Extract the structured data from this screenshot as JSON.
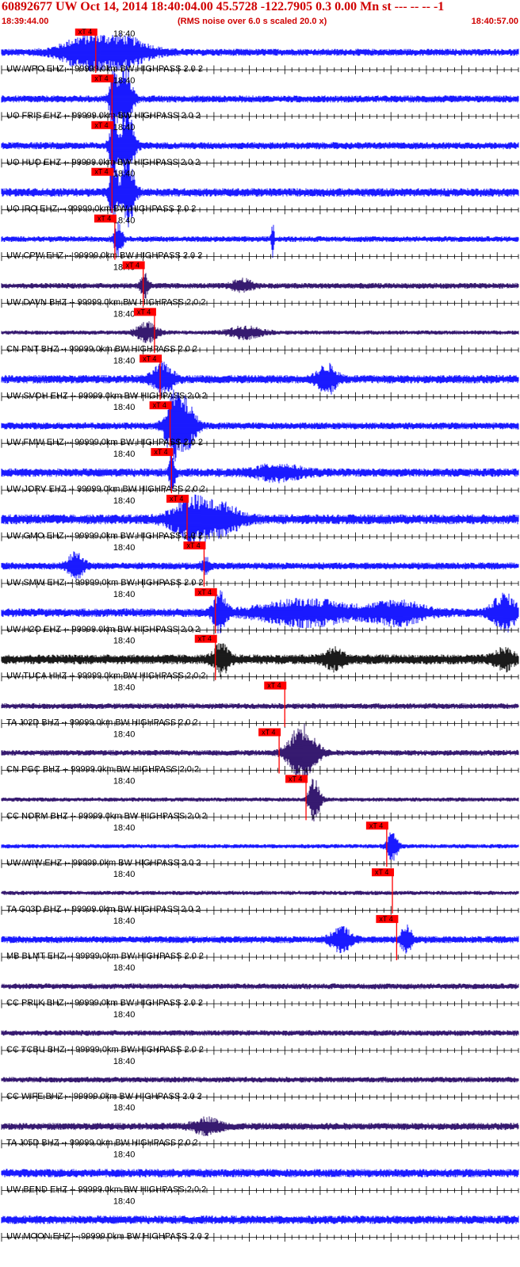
{
  "header": {
    "title": "60892677 UW Oct 14, 2014 18:40:04.00   45.5728 -122.7905  0.3 0.00 Mn st --- -- --  -1",
    "start_time": "18:39:44.00",
    "rms_note": "(RMS noise over 6.0 s scaled 20.0 x)",
    "end_time": "18:40:57.00"
  },
  "chart_data": {
    "type": "line",
    "title": "60892677 UW Oct 14, 2014 18:40:04.00   45.5728 -122.7905  0.3 0.00 Mn st --- -- --  -1",
    "x_range_seconds": [
      0,
      73
    ],
    "time_label": "18:40",
    "time_label_seconds": 16,
    "pick_label": "xT 4",
    "colors": {
      "blue": "#0000ff",
      "purple": "#200060",
      "black": "#000000",
      "pick": "#ff0000",
      "text_red": "#d00000"
    },
    "traces": [
      {
        "label": "UW WPO EHZ -- 99999.0km BW  HIGHPASS  2.0  2",
        "color": "blue",
        "noise": 0.25,
        "pick": 13.3,
        "events": [
          [
            11.5,
            3.5,
            0.9
          ],
          [
            17,
            4,
            1.0
          ]
        ]
      },
      {
        "label": "UO FRIS EHZ -- 99999.0km BW  HIGHPASS  2.0  2",
        "color": "blue",
        "noise": 0.25,
        "pick": 15.6,
        "events": [
          [
            15.8,
            0.6,
            2.0
          ],
          [
            17.5,
            1.0,
            2.2
          ]
        ]
      },
      {
        "label": "UO HUO EHZ -- 99999.0km BW  HIGHPASS  2.0  2",
        "color": "blue",
        "noise": 0.25,
        "pick": 15.6,
        "events": [
          [
            15.8,
            0.6,
            2.0
          ],
          [
            17.8,
            1.0,
            2.2
          ]
        ]
      },
      {
        "label": "UO IRO EHZ -- 99999.0km BW  HIGHPASS  2.0  2",
        "color": "blue",
        "noise": 0.3,
        "pick": 15.6,
        "events": [
          [
            15.8,
            0.6,
            2.0
          ],
          [
            17.8,
            1.0,
            2.2
          ]
        ]
      },
      {
        "label": "UW CPW EHZ -- 99999.0km BW  HIGHPASS  2.0  2",
        "color": "blue",
        "noise": 0.2,
        "pick": 16.0,
        "events": [
          [
            16.5,
            0.6,
            1.2
          ],
          [
            38.3,
            0.2,
            1.2
          ]
        ]
      },
      {
        "label": "UW DAVN BHZ -- 99999.0km BW  HIGHPASS  2.0  2",
        "color": "purple",
        "noise": 0.2,
        "pick": 20.0,
        "events": [
          [
            20.2,
            0.6,
            0.9
          ],
          [
            34,
            1.5,
            0.4
          ]
        ]
      },
      {
        "label": "CN PNT BHZ -- 99999.0km BW  HIGHPASS  2.0  2",
        "color": "purple",
        "noise": 0.15,
        "pick": 21.6,
        "events": [
          [
            20.5,
            1.5,
            0.7
          ],
          [
            34.5,
            2.5,
            0.4
          ]
        ]
      },
      {
        "label": "UW SVOH EHZ -- 99999.0km BW  HIGHPASS  2.0  2",
        "color": "blue",
        "noise": 0.3,
        "pick": 22.4,
        "events": [
          [
            22.8,
            1.5,
            1.0
          ],
          [
            46,
            1.5,
            0.9
          ]
        ]
      },
      {
        "label": "UW FMW EHZ -- 99999.0km BW  HIGHPASS  2.0  2",
        "color": "blue",
        "noise": 0.25,
        "pick": 23.8,
        "events": [
          [
            24.2,
            1.2,
            1.9
          ],
          [
            26,
            1.5,
            1.6
          ]
        ]
      },
      {
        "label": "UW JORV EHZ -- 99999.0km BW  HIGHPASS  2.0  2",
        "color": "blue",
        "noise": 0.3,
        "pick": 24.0,
        "events": [
          [
            24.1,
            0.4,
            1.4
          ],
          [
            39,
            3.5,
            0.45
          ]
        ]
      },
      {
        "label": "UW GMO EHZ -- 99999.0km BW  HIGHPASS  2.0  2",
        "color": "blue",
        "noise": 0.35,
        "pick": 26.2,
        "events": [
          [
            27,
            3,
            1.4
          ],
          [
            31.5,
            2.5,
            0.8
          ]
        ]
      },
      {
        "label": "UW SMW EHZ -- 99999.0km BW  HIGHPASS  2.0  2",
        "color": "blue",
        "noise": 0.25,
        "pick": 28.6,
        "events": [
          [
            10.5,
            1.2,
            0.9
          ],
          [
            28.8,
            0.6,
            0.5
          ]
        ]
      },
      {
        "label": "UW H2O EHZ -- 99999.0km BW  HIGHPASS  2.0  2",
        "color": "blue",
        "noise": 0.3,
        "pick": 30.2,
        "events": [
          [
            30.8,
            1,
            1.3
          ],
          [
            43,
            7,
            0.8
          ],
          [
            56,
            4,
            0.7
          ],
          [
            71,
            1.8,
            1.2
          ]
        ]
      },
      {
        "label": "UW TUCA HHZ -- 99999.0km BW  HIGHPASS  2.0  2",
        "color": "black",
        "noise": 0.35,
        "pick": 30.2,
        "events": [
          [
            31,
            1.2,
            0.9
          ],
          [
            47,
            1.5,
            0.6
          ],
          [
            71,
            1.5,
            0.6
          ]
        ]
      },
      {
        "label": "TA J02D BHZ -- 99999.0km BW  HIGHPASS  2.0  2",
        "color": "purple",
        "noise": 0.2,
        "pick": 40.0,
        "events": []
      },
      {
        "label": "CN PGC BHZ -- 99999.0km BW  HIGHPASS  2.0  2",
        "color": "purple",
        "noise": 0.2,
        "pick": 39.2,
        "events": [
          [
            42.5,
            2.0,
            2.0
          ]
        ]
      },
      {
        "label": "CC NORM BHZ -- 99999.0km BW  HIGHPASS  2.0  2",
        "color": "purple",
        "noise": 0.15,
        "pick": 43.0,
        "events": [
          [
            44.2,
            0.8,
            1.6
          ]
        ]
      },
      {
        "label": "UW WIW EHZ -- 99999.0km BW  HIGHPASS  2.0  2",
        "color": "blue",
        "noise": 0.15,
        "pick": 54.4,
        "events": [
          [
            55.2,
            0.8,
            1.0
          ]
        ]
      },
      {
        "label": "TA G03D BHZ -- 99999.0km BW  HIGHPASS  2.0  2",
        "color": "purple",
        "noise": 0.15,
        "pick": 55.2,
        "events": []
      },
      {
        "label": "MB BLMT EHZ -- 99999.0km BW  HIGHPASS  2.0  2",
        "color": "blue",
        "noise": 0.25,
        "pick": 55.8,
        "events": [
          [
            48,
            1.5,
            0.8
          ],
          [
            57.2,
            0.8,
            1.0
          ]
        ]
      },
      {
        "label": "CC PRLK BHZ -- 99999.0km BW  HIGHPASS  2.0  2",
        "color": "purple",
        "noise": 0.2,
        "pick": null,
        "events": []
      },
      {
        "label": "CC TCBU BHZ -- 99999.0km BW  HIGHPASS  2.0  2",
        "color": "purple",
        "noise": 0.2,
        "pick": null,
        "events": []
      },
      {
        "label": "CC WIFE BHZ -- 99999.0km BW  HIGHPASS  2.0  2",
        "color": "purple",
        "noise": 0.2,
        "pick": null,
        "events": []
      },
      {
        "label": "TA J05D BHZ -- 99999.0km BW  HIGHPASS  2.0  2",
        "color": "purple",
        "noise": 0.25,
        "pick": null,
        "events": [
          [
            29,
            2,
            0.5
          ]
        ]
      },
      {
        "label": "UW BEND EHZ -- 99999.0km BW  HIGHPASS  2.0  2",
        "color": "blue",
        "noise": 0.3,
        "pick": null,
        "events": []
      },
      {
        "label": "UW MOON EHZ -- 99999.0km BW  HIGHPASS  2.0  2",
        "color": "blue",
        "noise": 0.3,
        "pick": null,
        "events": []
      }
    ]
  }
}
